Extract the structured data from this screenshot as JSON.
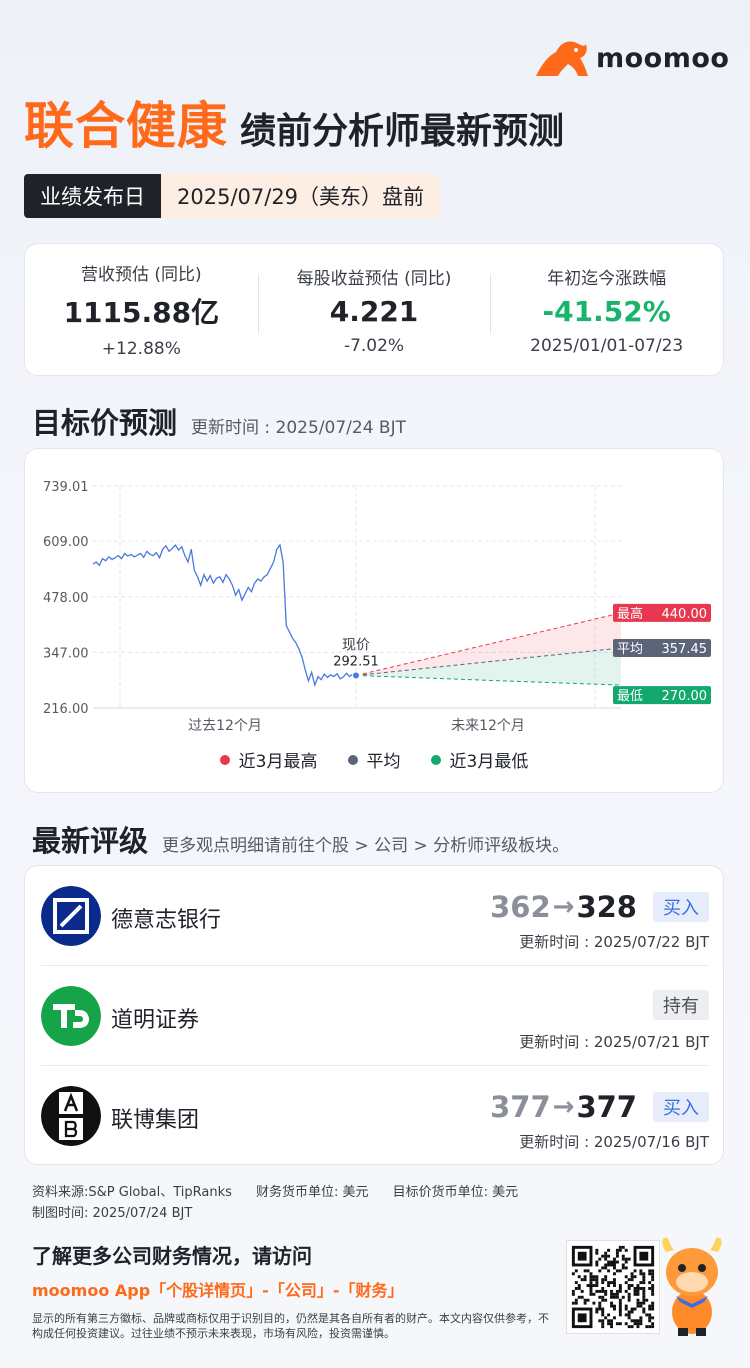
{
  "brand": {
    "name": "moomoo",
    "accent": "#ff6a1a"
  },
  "header": {
    "company": "联合健康",
    "subtitle": "绩前分析师最新预测",
    "date_label": "业绩发布日",
    "date_value": "2025/07/29（美东）盘前"
  },
  "summary": [
    {
      "label": "营收预估 (同比)",
      "value": "1115.88亿",
      "change": "+12.88%"
    },
    {
      "label": "每股收益预估 (同比)",
      "value": "4.221",
      "change": "-7.02%"
    },
    {
      "label": "年初迄今涨跌幅",
      "value": "-41.52%",
      "change": "2025/01/01-07/23"
    }
  ],
  "target_section": {
    "title": "目标价预测",
    "note": "更新时间 : 2025/07/24 BJT"
  },
  "chart_data": {
    "type": "line",
    "y_ticks": [
      "739.01",
      "609.00",
      "478.00",
      "347.00",
      "216.00"
    ],
    "ylim": [
      216,
      739.01
    ],
    "x_labels": [
      "过去12个月",
      "未来12个月"
    ],
    "current": {
      "label": "现价",
      "value": 292.51
    },
    "targets": [
      {
        "name": "最高",
        "value": 440.0,
        "display": "440.00",
        "color": "#e8384f"
      },
      {
        "name": "平均",
        "value": 357.45,
        "display": "357.45",
        "color": "#5b6478"
      },
      {
        "name": "最低",
        "value": 270.0,
        "display": "270.00",
        "color": "#12a86e"
      }
    ],
    "history": [
      555,
      560,
      552,
      568,
      563,
      572,
      566,
      570,
      575,
      568,
      580,
      574,
      578,
      572,
      576,
      580,
      571,
      585,
      578,
      575,
      582,
      570,
      590,
      598,
      585,
      592,
      600,
      588,
      596,
      575,
      560,
      590,
      540,
      525,
      505,
      530,
      515,
      528,
      510,
      522,
      525,
      512,
      530,
      520,
      505,
      482,
      495,
      470,
      485,
      500,
      490,
      510,
      520,
      515,
      525,
      530,
      545,
      560,
      590,
      600,
      560,
      410,
      395,
      380,
      370,
      355,
      335,
      305,
      280,
      300,
      270,
      290,
      283,
      296,
      288,
      294,
      290,
      297,
      285,
      289,
      298,
      290,
      296,
      292.51
    ],
    "legend": [
      {
        "label": "近3月最高",
        "color": "#e8384f"
      },
      {
        "label": "平均",
        "color": "#5b6478"
      },
      {
        "label": "近3月最低",
        "color": "#12a86e"
      }
    ]
  },
  "ratings_section": {
    "title": "最新评级",
    "note": "更多观点明细请前往个股 > 公司 > 分析师评级板块。"
  },
  "ratings": [
    {
      "broker": "德意志银行",
      "old": "362",
      "arrow": "→",
      "new": "328",
      "rating": "买入",
      "updated": "更新时间 : 2025/07/22 BJT",
      "logo": "deutsche-bank-icon"
    },
    {
      "broker": "道明证券",
      "old": "",
      "arrow": "",
      "new": "",
      "rating": "持有",
      "updated": "更新时间 : 2025/07/21 BJT",
      "logo": "td-icon"
    },
    {
      "broker": "联博集团",
      "old": "377",
      "arrow": "→",
      "new": "377",
      "rating": "买入",
      "updated": "更新时间 : 2025/07/16 BJT",
      "logo": "ab-icon"
    }
  ],
  "footer": {
    "source": "资料来源:S&P Global、TipRanks",
    "currency": "财务货币单位: 美元",
    "target_currency": "目标价货币单位: 美元",
    "made": "制图时间: 2025/07/24 BJT",
    "cta": "了解更多公司财务情况，请访问",
    "cta_link": "moomoo App「个股详情页」-「公司」-「财务」",
    "disclaimer": "显示的所有第三方徽标、品牌或商标仅用于识别目的，仍然是其各自所有者的财产。本文内容仅供参考，不构成任何投资建议。过往业绩不预示未来表现，市场有风险，投资需谨慎。"
  }
}
